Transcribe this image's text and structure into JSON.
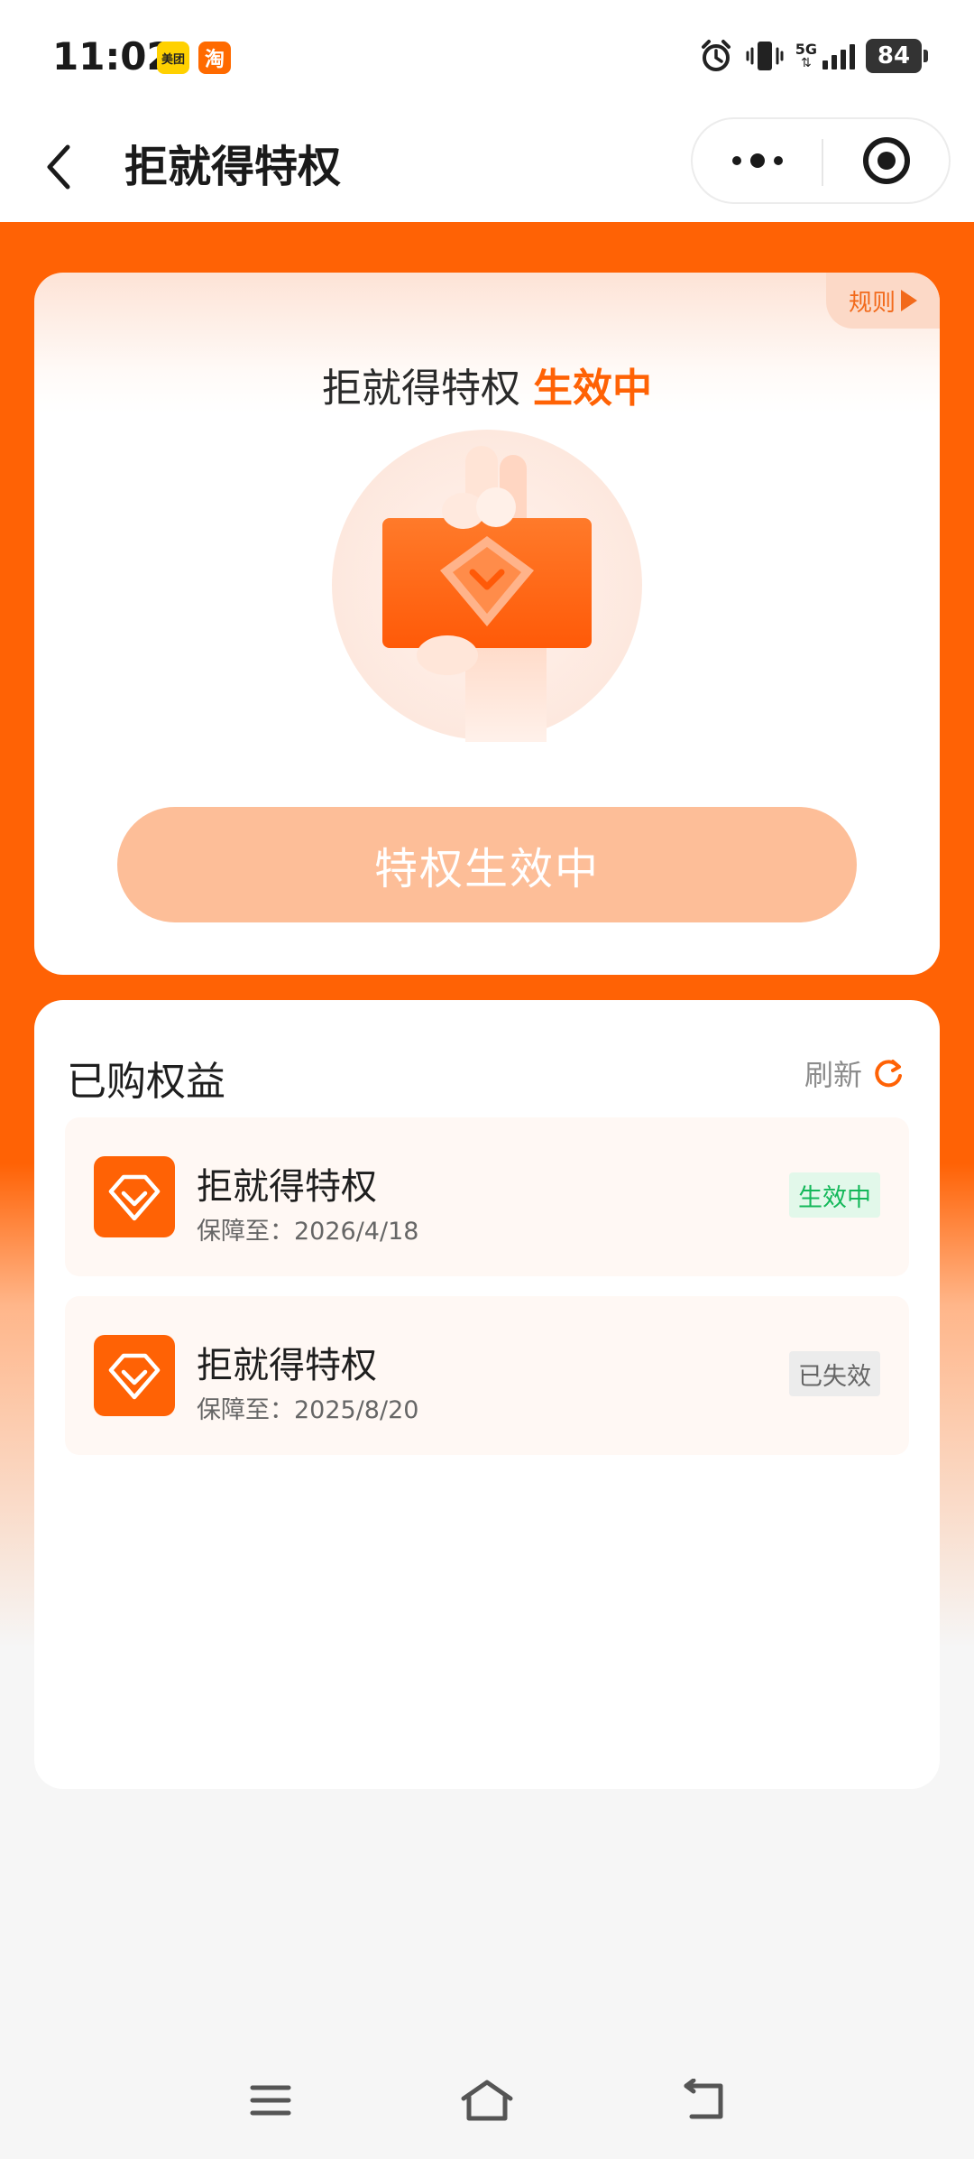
{
  "status_bar": {
    "time": "11:02",
    "app_badges": [
      "美团",
      "淘"
    ],
    "network": "5G",
    "battery": "84"
  },
  "title_bar": {
    "title": "拒就得特权"
  },
  "hero": {
    "rules_label": "规则",
    "heading": "拒就得特权",
    "heading_status": "生效中",
    "button_label": "特权生效中"
  },
  "purchased": {
    "title": "已购权益",
    "refresh_label": "刷新",
    "items": [
      {
        "name": "拒就得特权",
        "date_label": "保障至：2026/4/18",
        "status": "生效中",
        "status_type": "active"
      },
      {
        "name": "拒就得特权",
        "date_label": "保障至：2025/8/20",
        "status": "已失效",
        "status_type": "expired"
      }
    ]
  },
  "colors": {
    "brand_orange": "#ff6205",
    "button_disabled": "#fdbe98",
    "active_green": "#14b85a"
  }
}
